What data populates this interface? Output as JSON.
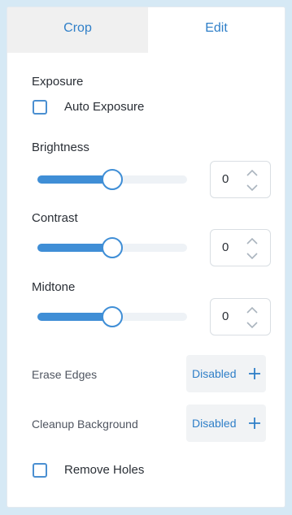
{
  "tabs": [
    {
      "label": "Crop",
      "active": false
    },
    {
      "label": "Edit",
      "active": true
    }
  ],
  "exposure": {
    "heading": "Exposure",
    "auto_exposure": {
      "label": "Auto Exposure",
      "checked": false
    }
  },
  "sliders": [
    {
      "label": "Brightness",
      "value": "0",
      "level": 0.5
    },
    {
      "label": "Contrast",
      "value": "0",
      "level": 0.5
    },
    {
      "label": "Midtone",
      "value": "0",
      "level": 0.5
    }
  ],
  "options": [
    {
      "label": "Erase Edges",
      "button_label": "Disabled",
      "icon": "plus-icon"
    },
    {
      "label": "Cleanup Background",
      "button_label": "Disabled",
      "icon": "plus-icon"
    }
  ],
  "remove_holes": {
    "label": "Remove Holes",
    "checked": false
  },
  "colors": {
    "accent": "#3f8ed6",
    "tab_text": "#2f7fc8",
    "background": "#d6e9f5"
  }
}
